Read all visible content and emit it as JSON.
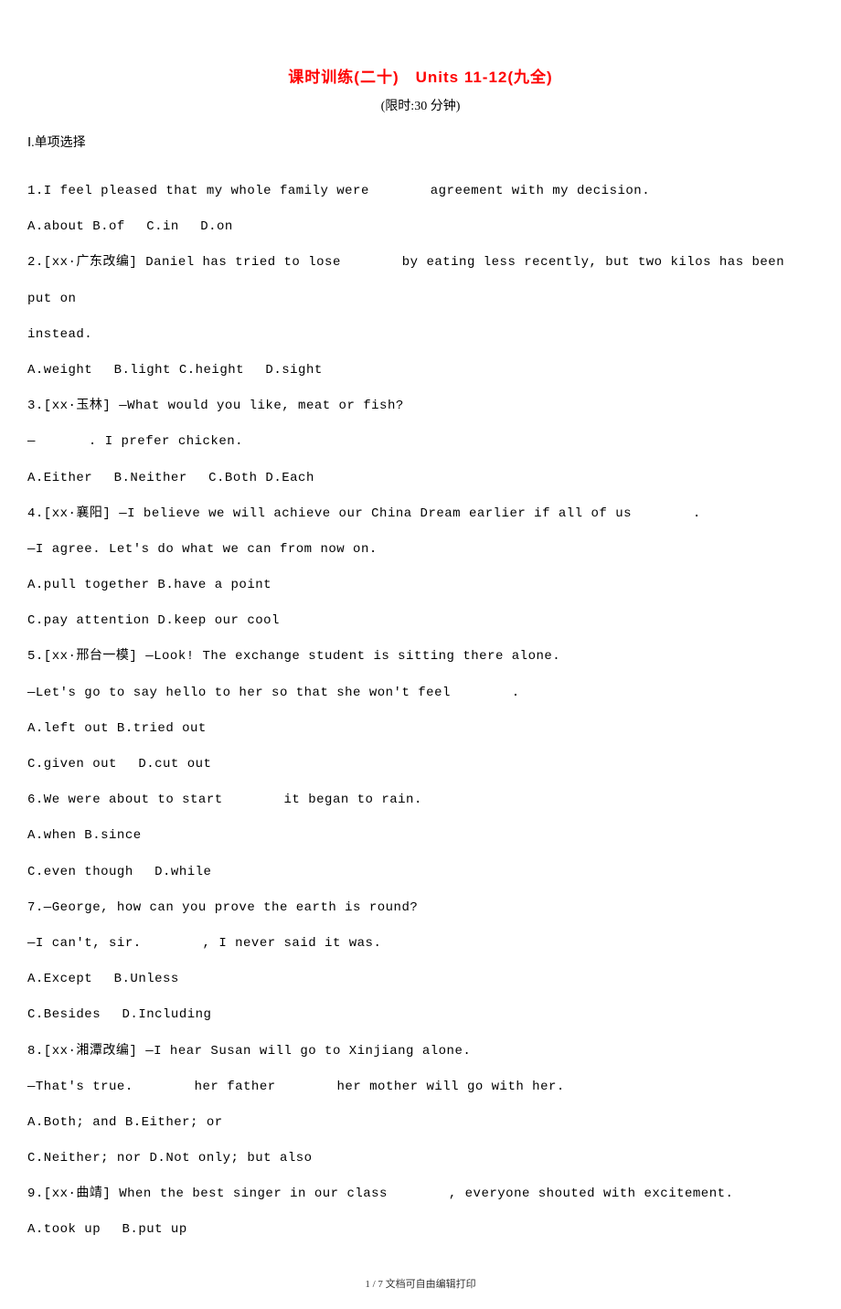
{
  "title": "课时训练(二十)　Units 11-12(九全)",
  "subtitle": "(限时:30 分钟)",
  "section1_header": "Ⅰ.单项选择",
  "lines": {
    "q1": "1.I feel pleased that my whole family were 　　　　agreement with my decision.",
    "q1opts": "A.about B.of  C.in  D.on",
    "q2a": "2.[xx·广东改编] Daniel has tried to lose 　　　　by eating less recently, but two kilos has been put on",
    "q2b": "instead.",
    "q2opts": "A.weight  B.light C.height  D.sight",
    "q3a": "3.[xx·玉林] —What would you like, meat or fish?",
    "q3b": "—　　　　. I prefer chicken.",
    "q3opts": "A.Either  B.Neither  C.Both  D.Each",
    "q4a": "4.[xx·襄阳] —I believe we will achieve our China Dream earlier if all of us 　　　　.",
    "q4b": "—I agree. Let's do what we can from now on.",
    "q4opts1": "A.pull together B.have a point",
    "q4opts2": "C.pay attention D.keep our cool",
    "q5a": "5.[xx·邢台一模] —Look! The exchange student is sitting there alone.",
    "q5b": "—Let's go to say hello to her so that she won't feel 　　　　.",
    "q5opts1": "A.left out  B.tried out",
    "q5opts2": "C.given out  D.cut out",
    "q6a": "6.We were about to start 　　　　it began to rain.",
    "q6opts1": "A.when  B.since",
    "q6opts2": "C.even though  D.while",
    "q7a": "7.—George, how can you prove the earth is round?",
    "q7b": "—I can't, sir. 　　　　, I never said it was.",
    "q7opts1": "A.Except  B.Unless",
    "q7opts2": "C.Besides  D.Including",
    "q8a": "8.[xx·湘潭改编] —I hear Susan will go to Xinjiang alone.",
    "q8b": "—That's true. 　　　　her father 　　　　her mother will go with her.",
    "q8opts1": "A.Both; and B.Either; or",
    "q8opts2": "C.Neither; nor  D.Not only; but also",
    "q9a": "9.[xx·曲靖] When the best singer in our class 　　　　, everyone shouted with excitement.",
    "q9opts1": "A.took up  B.put up"
  },
  "footer": "1 / 7 文档可自由编辑打印"
}
